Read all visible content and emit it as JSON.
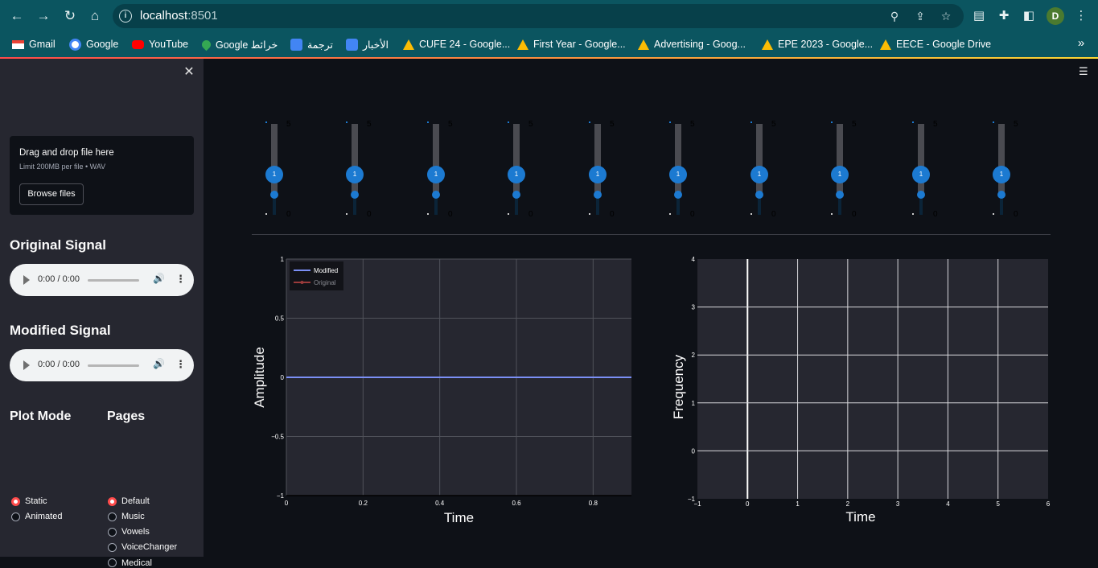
{
  "browser": {
    "url_host": "localhost",
    "url_port": ":8501",
    "avatar_letter": "D",
    "bookmarks": [
      {
        "label": "Gmail",
        "icon": "gmail-icon",
        "color": "#ea4335"
      },
      {
        "label": "Google",
        "icon": "google-icon",
        "color": "#4285f4"
      },
      {
        "label": "YouTube",
        "icon": "youtube-icon",
        "color": "#ff0000"
      },
      {
        "label": "Google خرائط",
        "icon": "maps-icon",
        "color": "#34a853"
      },
      {
        "label": "ترجمة",
        "icon": "translate-icon",
        "color": "#4285f4"
      },
      {
        "label": "الأخبار",
        "icon": "news-icon",
        "color": "#4285f4"
      },
      {
        "label": "CUFE 24 - Google...",
        "icon": "drive-icon",
        "color": "#fbbc04"
      },
      {
        "label": "First Year - Google...",
        "icon": "drive-icon",
        "color": "#fbbc04"
      },
      {
        "label": "Advertising - Goog...",
        "icon": "drive-icon",
        "color": "#fbbc04"
      },
      {
        "label": "EPE 2023 - Google...",
        "icon": "drive-icon",
        "color": "#fbbc04"
      },
      {
        "label": "EECE - Google Drive",
        "icon": "drive-icon",
        "color": "#fbbc04"
      }
    ]
  },
  "sidebar": {
    "uploader": {
      "title": "Drag and drop file here",
      "limit": "Limit 200MB per file • WAV",
      "button": "Browse files"
    },
    "original_title": "Original Signal",
    "modified_title": "Modified Signal",
    "audio_time": "0:00 / 0:00",
    "plot_mode": {
      "title": "Plot Mode",
      "options": [
        "Static",
        "Animated"
      ],
      "selected": "Static"
    },
    "pages": {
      "title": "Pages",
      "options": [
        "Default",
        "Music",
        "Vowels",
        "VoiceChanger",
        "Medical"
      ],
      "selected": "Default"
    }
  },
  "sliders": {
    "max_label": "5",
    "min_label": "0",
    "values": [
      1,
      1,
      1,
      1,
      1,
      1,
      1,
      1,
      1,
      1
    ]
  },
  "chart_data": [
    {
      "type": "line",
      "xlabel": "Time",
      "ylabel": "Amplitude",
      "xlim": [
        0,
        0.9
      ],
      "ylim": [
        -1,
        1
      ],
      "xticks": [
        "0",
        "0.2",
        "0.4",
        "0.6",
        "0.8"
      ],
      "yticks": [
        "1",
        "0.5",
        "0",
        "−0.5",
        "−1"
      ],
      "legend_placement": "top-left",
      "series": [
        {
          "name": "Modified",
          "color": "#7b8ff5",
          "x": [
            0,
            0.9
          ],
          "y": [
            0,
            0
          ]
        },
        {
          "name": "Original",
          "color": "#9b3b3b",
          "x": [],
          "y": []
        }
      ]
    },
    {
      "type": "heatmap",
      "xlabel": "Time",
      "ylabel": "Frequency",
      "xlim": [
        -1,
        6
      ],
      "ylim": [
        -1,
        4
      ],
      "xticks": [
        "−1",
        "0",
        "1",
        "2",
        "3",
        "4",
        "5",
        "6"
      ],
      "yticks": [
        "4",
        "3",
        "2",
        "1",
        "0",
        "−1"
      ],
      "grid": true
    }
  ]
}
